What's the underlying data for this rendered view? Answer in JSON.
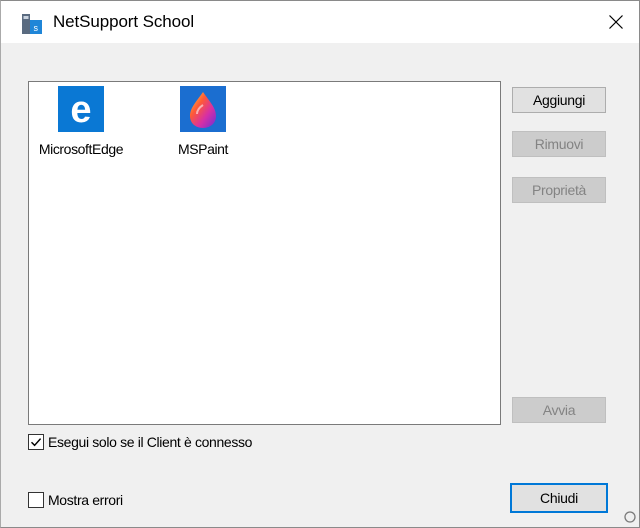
{
  "window": {
    "title": "NetSupport School",
    "close_symbol": "✕"
  },
  "app_list": {
    "items": [
      {
        "label": "MicrosoftEdge",
        "icon": "microsoft-edge-icon"
      },
      {
        "label": "MSPaint",
        "icon": "ms-paint-icon"
      }
    ]
  },
  "buttons": {
    "add": "Aggiungi",
    "remove": "Rimuovi",
    "properties": "Proprietà",
    "run": "Avvia",
    "close": "Chiudi"
  },
  "options": {
    "run_only_if_connected": {
      "label": "Esegui solo se il Client è connesso",
      "checked": true
    },
    "show_errors": {
      "label": "Mostra errori",
      "checked": false
    }
  },
  "colors": {
    "edge_blue": "#0a78d4",
    "paint_bg": "#1b6ed0",
    "accent": "#0078d7"
  }
}
